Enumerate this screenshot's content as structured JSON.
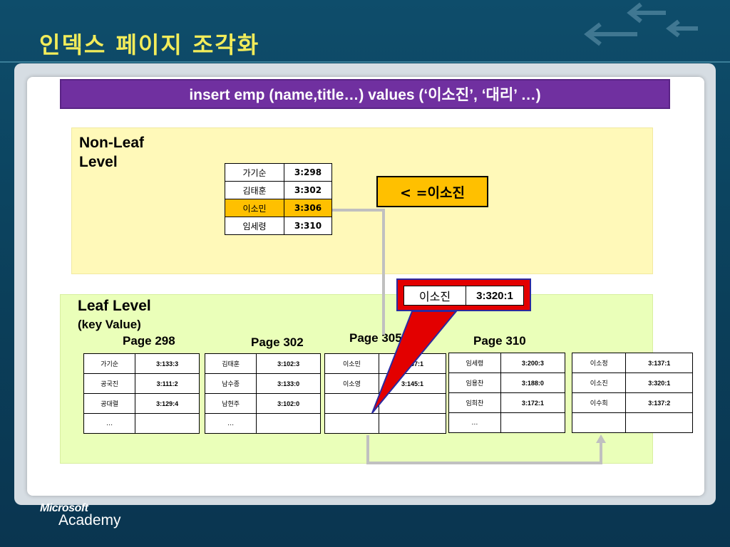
{
  "slide_title": "인덱스 페이지 조각화",
  "banner_text": "insert emp (name,title…)  values (‘이소진’, ‘대리’ …)",
  "non_leaf": {
    "label_line1": "Non-Leaf",
    "label_line2": "Level",
    "rows": [
      {
        "key": "가기순",
        "ptr": "3:298"
      },
      {
        "key": "김태훈",
        "ptr": "3:302"
      },
      {
        "key": "이소민",
        "ptr": "3:306"
      },
      {
        "key": "임세령",
        "ptr": "3:310"
      }
    ],
    "condition": "< =이소진"
  },
  "new_entry": {
    "key": "이소진",
    "rid": "3:320:1"
  },
  "leaf": {
    "label": "Leaf Level",
    "sub_label": "(key Value)",
    "pages": [
      {
        "label": "Page 298",
        "rows": [
          [
            "가기순",
            "3:133:3"
          ],
          [
            "공국진",
            "3:111:2"
          ],
          [
            "공대렬",
            "3:129:4"
          ],
          [
            "…",
            ""
          ]
        ]
      },
      {
        "label": "Page 302",
        "rows": [
          [
            "김태훈",
            "3:102:3"
          ],
          [
            "남수종",
            "3:133:0"
          ],
          [
            "남현주",
            "3:102:0"
          ],
          [
            "…",
            ""
          ]
        ]
      },
      {
        "label": "Page 305",
        "rows": [
          [
            "이소민",
            "3:137:1"
          ],
          [
            "이소영",
            "3:145:1"
          ],
          [
            "",
            ""
          ],
          [
            "",
            ""
          ]
        ]
      },
      {
        "label": "Page 310",
        "rows": [
          [
            "임세령",
            "3:200:3"
          ],
          [
            "임용찬",
            "3:188:0"
          ],
          [
            "임희찬",
            "3:172:1"
          ],
          [
            "…",
            ""
          ]
        ]
      },
      {
        "label": "",
        "rows": [
          [
            "이소정",
            "3:137:1"
          ],
          [
            "이소진",
            "3:320:1"
          ],
          [
            "이수희",
            "3:137:2"
          ],
          [
            "",
            ""
          ]
        ]
      }
    ]
  },
  "logo": {
    "brand": "Microsoft",
    "product": "Academy"
  },
  "colors": {
    "banner": "#7030a0",
    "highlight": "#ffc000",
    "arrow": "#e30000",
    "title": "#f2ec5a"
  }
}
